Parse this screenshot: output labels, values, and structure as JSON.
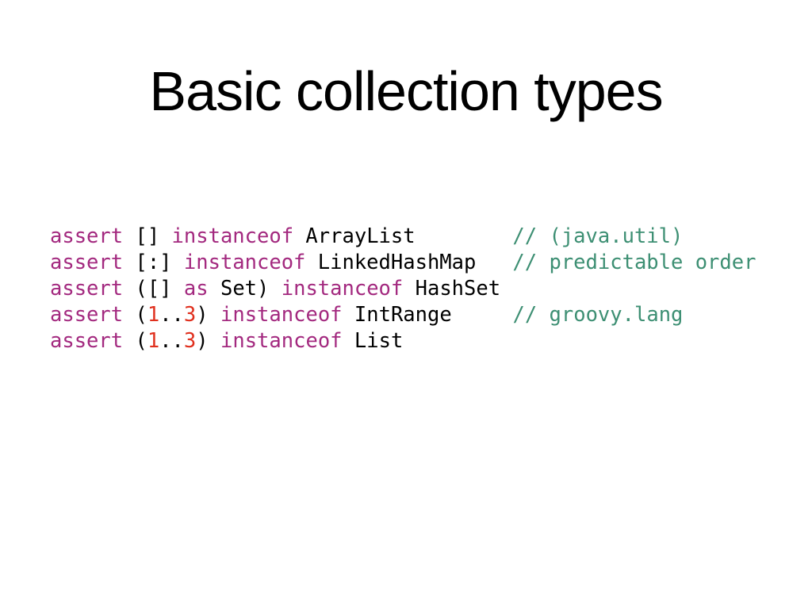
{
  "slide": {
    "title": "Basic collection types",
    "colors": {
      "keyword": "#a3297f",
      "number": "#e0301e",
      "comment": "#3d8f73",
      "plain": "#000000"
    },
    "code_lines": [
      [
        {
          "t": "kw",
          "v": "assert"
        },
        {
          "t": "pl",
          "v": " [] "
        },
        {
          "t": "kw",
          "v": "instanceof"
        },
        {
          "t": "pl",
          "v": " ArrayList        "
        },
        {
          "t": "cm",
          "v": "// (java.util)"
        }
      ],
      [
        {
          "t": "kw",
          "v": "assert"
        },
        {
          "t": "pl",
          "v": " [:] "
        },
        {
          "t": "kw",
          "v": "instanceof"
        },
        {
          "t": "pl",
          "v": " LinkedHashMap   "
        },
        {
          "t": "cm",
          "v": "// predictable order"
        }
      ],
      [
        {
          "t": "kw",
          "v": "assert"
        },
        {
          "t": "pl",
          "v": " ([] "
        },
        {
          "t": "kw",
          "v": "as"
        },
        {
          "t": "pl",
          "v": " Set) "
        },
        {
          "t": "kw",
          "v": "instanceof"
        },
        {
          "t": "pl",
          "v": " HashSet"
        }
      ],
      [
        {
          "t": "kw",
          "v": "assert"
        },
        {
          "t": "pl",
          "v": " ("
        },
        {
          "t": "num",
          "v": "1"
        },
        {
          "t": "pl",
          "v": ".."
        },
        {
          "t": "num",
          "v": "3"
        },
        {
          "t": "pl",
          "v": ") "
        },
        {
          "t": "kw",
          "v": "instanceof"
        },
        {
          "t": "pl",
          "v": " IntRange     "
        },
        {
          "t": "cm",
          "v": "// groovy.lang"
        }
      ],
      [
        {
          "t": "kw",
          "v": "assert"
        },
        {
          "t": "pl",
          "v": " ("
        },
        {
          "t": "num",
          "v": "1"
        },
        {
          "t": "pl",
          "v": ".."
        },
        {
          "t": "num",
          "v": "3"
        },
        {
          "t": "pl",
          "v": ") "
        },
        {
          "t": "kw",
          "v": "instanceof"
        },
        {
          "t": "pl",
          "v": " List"
        }
      ]
    ]
  }
}
